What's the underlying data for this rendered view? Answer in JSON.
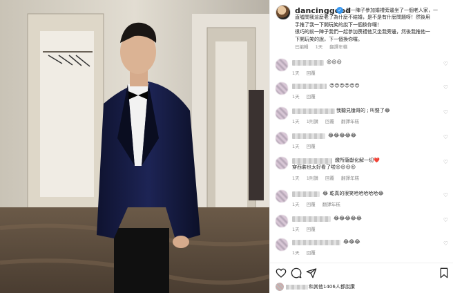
{
  "post": {
    "owner": "dancinggood",
    "verified_mark": "✓",
    "caption_first": "前一陣子參加婚禮旁邊坐了一個老人家，一",
    "caption_lines": [
      "直噓問我這麼老了為什麼不結婚，是不是有什麼問題呀！然後用",
      "手推了我一下開玩笑的說下一個換你囉！",
      "很巧的前一陣子我們一起參加喪禮他又坐我旁邊，然後我推他一",
      "下開玩笑的說，下一個換你囉。"
    ],
    "caption_meta": [
      "已編輯",
      "1天",
      "翻譯年糕"
    ]
  },
  "comments": [
    {
      "line1": "😍😍😍",
      "meta": [
        "1天",
        "回覆"
      ]
    },
    {
      "line1": "😍😍😍😍😍😍",
      "meta": [
        "1天",
        "回覆"
      ]
    },
    {
      "line1": "我聽見槍哥的 ; 叫聲了😂",
      "meta": [
        "1天",
        "1則讚",
        "回覆",
        "翻譯年糕"
      ]
    },
    {
      "line1": "😂😂😂😂😂",
      "meta": [
        "1天",
        "回覆"
      ]
    },
    {
      "line1": "繳所薩獻化解一切❤️",
      "line2": "穿西裝也太好看了啦😍😍😍😍",
      "meta": [
        "1天",
        "1則讚",
        "回覆",
        "翻譯年糕"
      ]
    },
    {
      "line1": "😂 乾真的很笑哈哈哈哈哈😂",
      "meta": [
        "1天",
        "回覆",
        "翻譯年糕"
      ]
    },
    {
      "line1": "😂😂😂😂😂",
      "meta": [
        "1天",
        "回覆"
      ]
    },
    {
      "line1": "😂😂😂",
      "meta": [
        "1天",
        "回覆"
      ]
    }
  ],
  "actions": {
    "like_icon": "heart-icon",
    "comment_icon": "comment-icon",
    "share_icon": "share-icon",
    "save_icon": "bookmark-icon"
  },
  "likes_text": "和其他1406人都說讚"
}
